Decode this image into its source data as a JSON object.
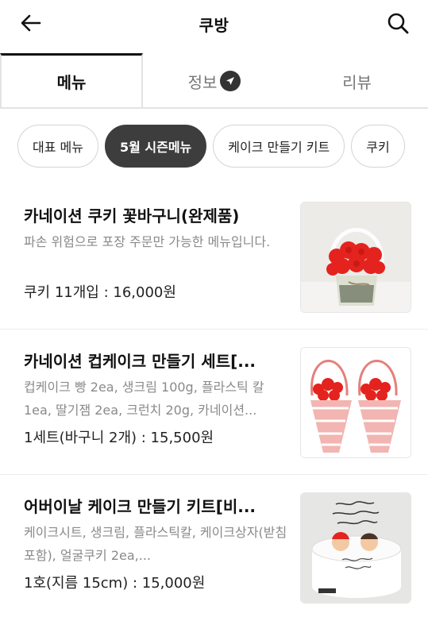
{
  "header": {
    "title": "쿠방",
    "back_icon": "back-arrow-icon",
    "search_icon": "search-icon"
  },
  "tabs": [
    {
      "label": "메뉴",
      "active": true
    },
    {
      "label": "정보",
      "badge_icon": "send-icon"
    },
    {
      "label": "리뷰"
    }
  ],
  "chips": [
    {
      "label": "대표 메뉴"
    },
    {
      "label": "5월 시즌메뉴",
      "active": true
    },
    {
      "label": "케이크 만들기 키트"
    },
    {
      "label": "쿠키"
    }
  ],
  "menu": [
    {
      "name": "카네이션 쿠키 꽃바구니(완제품)",
      "desc": "파손 위험으로 포장 주문만 가능한 메뉴입니다.",
      "price": "쿠키 11개입 : 16,000원"
    },
    {
      "name": "카네이션 컵케이크 만들기 세트[...",
      "desc": "컵케이크 빵 2ea, 생크림 100g, 플라스틱 칼 1ea, 딸기잼 2ea, 크런치 20g, 카네이션...",
      "price": "1세트(바구니 2개) : 15,500원"
    },
    {
      "name": "어버이날 케이크 만들기 키트[비...",
      "desc": "케이크시트, 생크림, 플라스틱칼, 케이크상자(받침포함), 얼굴쿠키 2ea,...",
      "price": "1호(지름 15cm) : 15,000원"
    }
  ],
  "colors": {
    "chip_active_bg": "#3d3d3d",
    "tab_active_border": "#111111",
    "carnation_red": "#e4231e"
  }
}
